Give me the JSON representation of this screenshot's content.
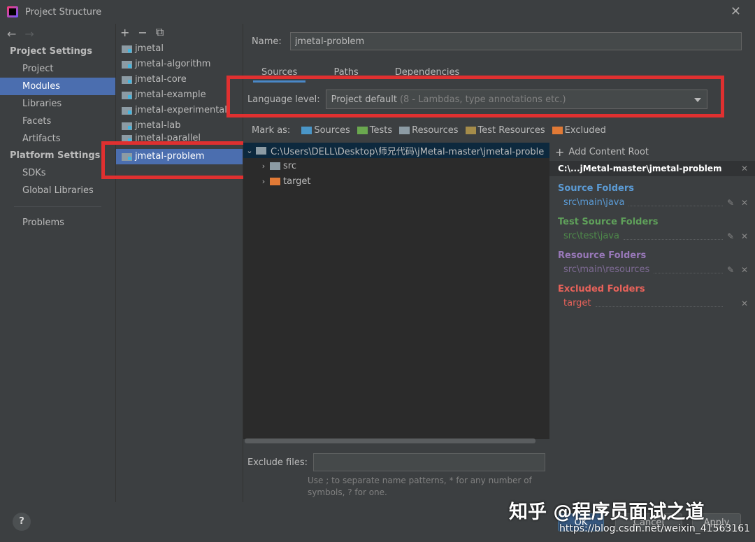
{
  "window": {
    "title": "Project Structure"
  },
  "nav": {
    "project_settings": "Project Settings",
    "project_items": [
      "Project",
      "Modules",
      "Libraries",
      "Facets",
      "Artifacts"
    ],
    "platform_settings": "Platform Settings",
    "platform_items": [
      "SDKs",
      "Global Libraries"
    ],
    "problems": "Problems",
    "selected": "Modules"
  },
  "modules": {
    "items": [
      "jmetal",
      "jmetal-algorithm",
      "jmetal-core",
      "jmetal-example",
      "jmetal-experimental",
      "jmetal-lab",
      "jmetal-parallel",
      "jmetal-problem"
    ],
    "selected": "jmetal-problem"
  },
  "main": {
    "name_label": "Name:",
    "name_value": "jmetal-problem",
    "tabs": [
      "Sources",
      "Paths",
      "Dependencies"
    ],
    "active_tab": "Sources",
    "language_level_label": "Language level:",
    "language_level_value": "Project default",
    "language_level_hint": "(8 - Lambdas, type annotations etc.)",
    "mark_as_label": "Mark as:",
    "mark_as": [
      "Sources",
      "Tests",
      "Resources",
      "Test Resources",
      "Excluded"
    ],
    "tree": {
      "root": "C:\\Users\\DELL\\Desktop\\师兄代码\\jMetal-master\\jmetal-proble",
      "children": [
        "src",
        "target"
      ]
    },
    "exclude_label": "Exclude files:",
    "exclude_hint": "Use ; to separate name patterns, * for any number of symbols, ? for one."
  },
  "right_panel": {
    "add_content_root": "Add Content Root",
    "root_path": "C:\\...jMetal-master\\jmetal-problem",
    "groups": [
      {
        "title": "Source Folders",
        "entry": "src\\main\\java",
        "color": "#5b9bd5",
        "entry_color": "#5b9bd5",
        "editable": true
      },
      {
        "title": "Test Source Folders",
        "entry": "src\\test\\java",
        "color": "#5fa05a",
        "entry_color": "#4e8a4a",
        "editable": true
      },
      {
        "title": "Resource Folders",
        "entry": "src\\main\\resources",
        "color": "#9878b8",
        "entry_color": "#7d6a93",
        "editable": true
      },
      {
        "title": "Excluded Folders",
        "entry": "target",
        "color": "#e8625a",
        "entry_color": "#e8625a",
        "editable": false
      }
    ]
  },
  "footer": {
    "help": "?",
    "ok": "OK",
    "cancel": "Cancel",
    "apply": "Apply"
  },
  "watermark": {
    "text": "知乎 @程序员面试之道",
    "url": "https://blog.csdn.net/weixin_41563161"
  },
  "colors": {
    "accent": "#4b6eaf",
    "highlight_box": "#e03030"
  }
}
